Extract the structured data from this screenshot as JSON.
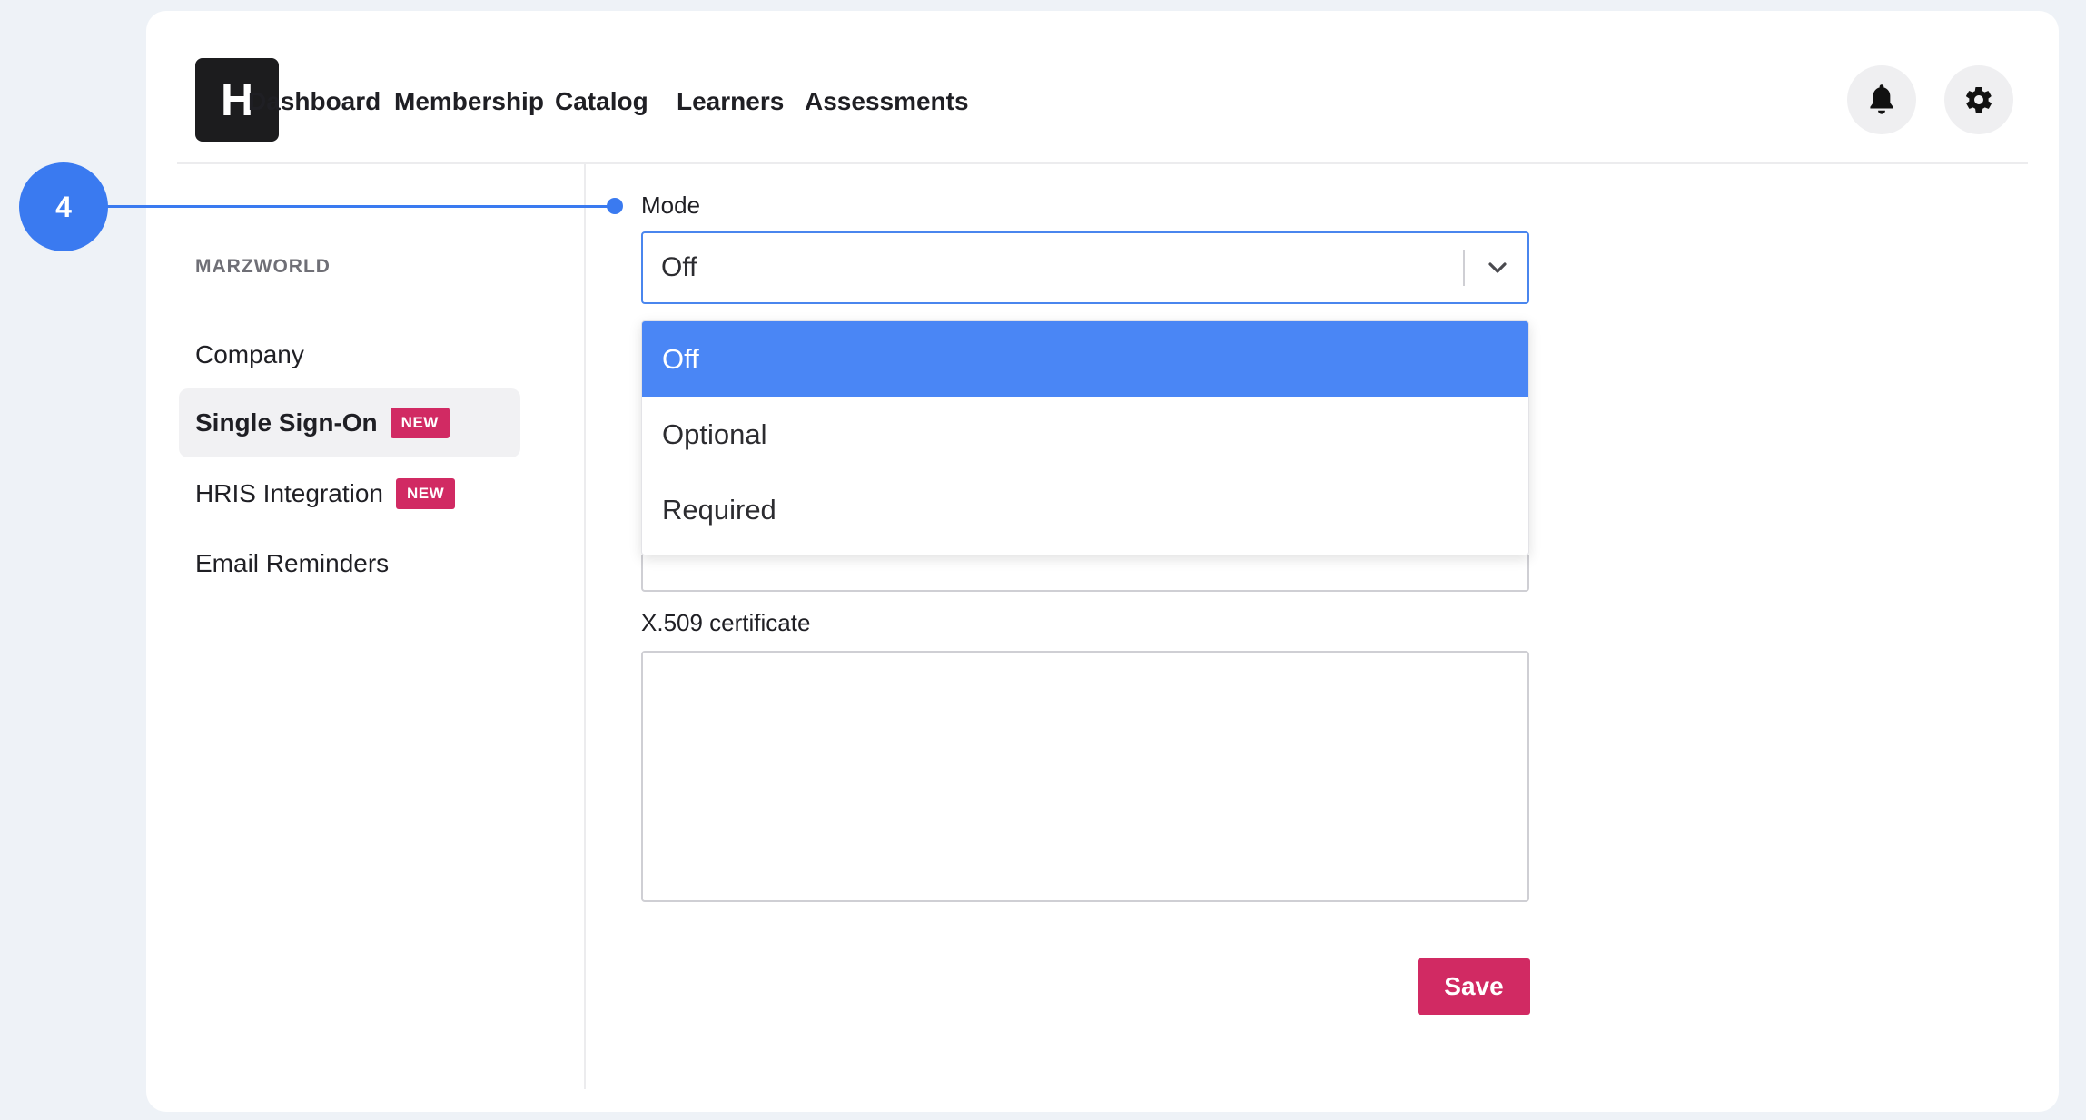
{
  "header": {
    "logo_letter": "H",
    "nav": [
      "Dashboard",
      "Membership",
      "Catalog",
      "Learners",
      "Assessments"
    ]
  },
  "sidebar": {
    "org_name": "MARZWORLD",
    "items": [
      {
        "label": "Company",
        "badge": ""
      },
      {
        "label": "Single Sign-On",
        "badge": "NEW",
        "active": true
      },
      {
        "label": "HRIS Integration",
        "badge": "NEW"
      },
      {
        "label": "Email Reminders",
        "badge": ""
      }
    ]
  },
  "form": {
    "mode_label": "Mode",
    "mode_value": "Off",
    "mode_options": [
      "Off",
      "Optional",
      "Required"
    ],
    "cert_label": "X.509 certificate",
    "cert_value": "",
    "save_label": "Save"
  },
  "callout": {
    "step_number": "4"
  },
  "colors": {
    "accent_blue": "#3a7af0",
    "selected_option": "#4a86f5",
    "brand_pink": "#d12a63",
    "background": "#eef2f7"
  },
  "icons": {
    "notifications": "bell-icon",
    "settings": "gear-icon",
    "select_toggle": "chevron-down-icon"
  }
}
